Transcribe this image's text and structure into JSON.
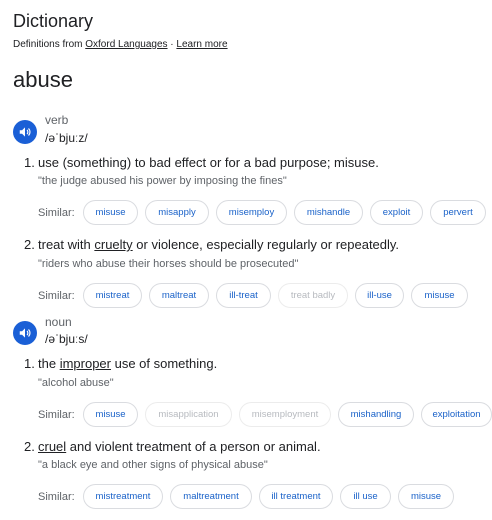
{
  "header": {
    "title": "Dictionary",
    "source_prefix": "Definitions from ",
    "source_link": "Oxford Languages",
    "separator": " · ",
    "learn_more": "Learn more"
  },
  "headword": "abuse",
  "similar_label": "Similar:",
  "icons": {
    "pronunciation": "speaker-icon"
  },
  "colors": {
    "accent": "#1a5fd6",
    "link_chip": "#1a62c9",
    "dim_chip": "#b7babf"
  },
  "verb": {
    "pos": "verb",
    "ipa": "/əˈbjuːz/",
    "senses": [
      {
        "num": "1.",
        "definition": "use (something) to bad effect or for a bad purpose; misuse.",
        "example": "\"the judge abused his power by imposing the fines\"",
        "similar": [
          "misuse",
          "misapply",
          "misemploy",
          "mishandle",
          "exploit",
          "pervert"
        ]
      },
      {
        "num": "2.",
        "def_before": "treat with ",
        "def_link": "cruelty",
        "def_after": " or violence, especially regularly or repeatedly.",
        "example": "\"riders who abuse their horses should be prosecuted\"",
        "similar": [
          "mistreat",
          "maltreat",
          "ill-treat",
          "treat badly",
          "ill-use",
          "misuse"
        ]
      }
    ]
  },
  "noun": {
    "pos": "noun",
    "ipa": "/əˈbjuːs/",
    "senses": [
      {
        "num": "1.",
        "def_before": "the ",
        "def_link": "improper",
        "def_after": " use of something.",
        "example": "\"alcohol abuse\"",
        "similar": [
          "misuse",
          "misapplication",
          "misemployment",
          "mishandling",
          "exploitation"
        ]
      },
      {
        "num": "2.",
        "def_before": "",
        "def_link": "cruel",
        "def_after": " and violent treatment of a person or animal.",
        "example": "\"a black eye and other signs of physical abuse\"",
        "similar": [
          "mistreatment",
          "maltreatment",
          "ill treatment",
          "ill use",
          "misuse"
        ]
      }
    ]
  }
}
